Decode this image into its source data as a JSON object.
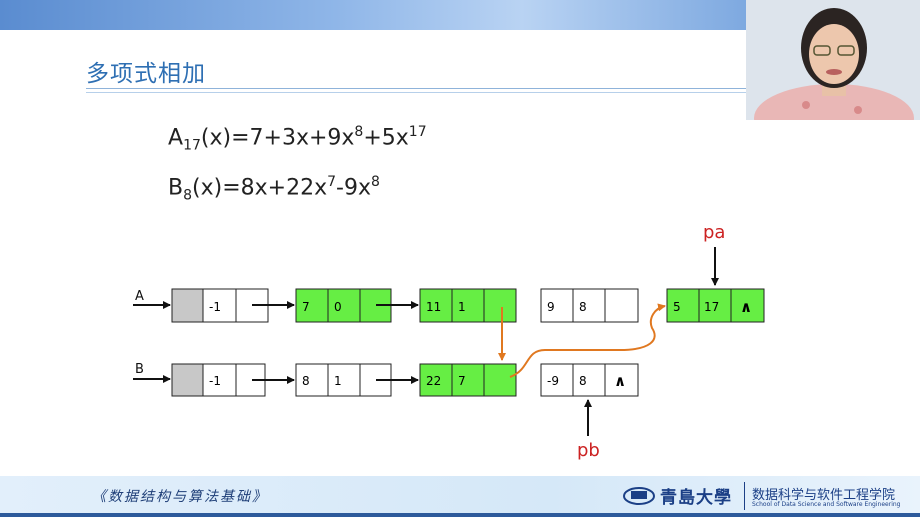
{
  "slide": {
    "title": "多项式相加"
  },
  "formulas": {
    "a": {
      "name": "A",
      "sub": "17",
      "arg": "(x)=7+3x+9x",
      "e1": "8",
      "mid": "+5x",
      "e2": "17"
    },
    "b": {
      "name": "B",
      "sub": "8",
      "arg": "(x)=8x+22x",
      "e1": "7",
      "mid": "-9x",
      "e2": "8"
    }
  },
  "diagram": {
    "list_a": {
      "label": "A",
      "nodes": [
        {
          "coef": "",
          "exp": "-1",
          "head": true,
          "highlight": false
        },
        {
          "coef": "7",
          "exp": "0",
          "head": false,
          "highlight": true
        },
        {
          "coef": "11",
          "exp": "1",
          "head": false,
          "highlight": true
        },
        {
          "coef": "9",
          "exp": "8",
          "head": false,
          "highlight": false
        },
        {
          "coef": "5",
          "exp": "17",
          "head": false,
          "highlight": true,
          "null": "∧"
        }
      ]
    },
    "list_b": {
      "label": "B",
      "nodes": [
        {
          "coef": "",
          "exp": "-1",
          "head": true,
          "highlight": false
        },
        {
          "coef": "8",
          "exp": "1",
          "head": false,
          "highlight": false
        },
        {
          "coef": "22",
          "exp": "7",
          "head": false,
          "highlight": true
        },
        {
          "coef": "-9",
          "exp": "8",
          "head": false,
          "highlight": false,
          "null": "∧"
        }
      ]
    },
    "pointer_a": "pa",
    "pointer_b": "pb",
    "colors": {
      "highlight": "#66ee44",
      "head": "#c8c8c8",
      "link": "#e07820",
      "pointer_label": "#cc2222"
    }
  },
  "footer": {
    "course": "《数据结构与算法基础》",
    "university": "青島大學",
    "school_cn": "数据科学与软件工程学院",
    "school_en": "School of Data Science and Software Engineering"
  }
}
